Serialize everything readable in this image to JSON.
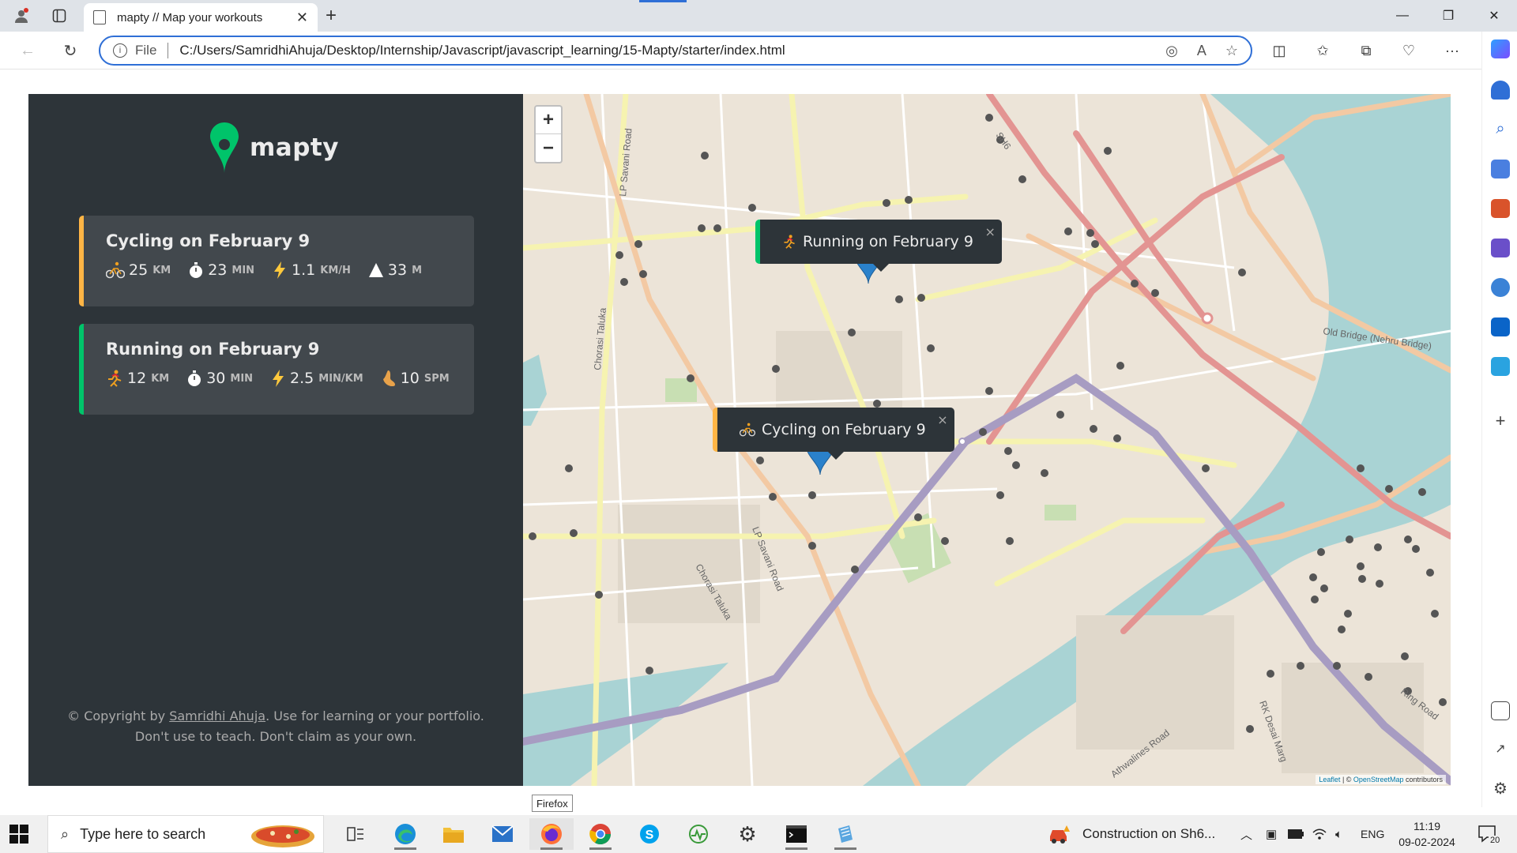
{
  "browser": {
    "tab_title": "mapty // Map your workouts",
    "scheme_label": "File",
    "url": "C:/Users/SamridhiAhuja/Desktop/Internship/Javascript/javascript_learning/15-Mapty/starter/index.html"
  },
  "app": {
    "logo_text": "mapty",
    "brand_colors": {
      "sidebar": "#2d3439",
      "card": "#42484d",
      "running": "#00c46a",
      "cycling": "#ffb545"
    },
    "workouts": [
      {
        "type": "cycling",
        "title": "Cycling on February 9",
        "distance": "25",
        "distance_unit": "KM",
        "duration": "23",
        "duration_unit": "MIN",
        "speed": "1.1",
        "speed_unit": "KM/H",
        "elevation": "33",
        "elevation_unit": "M"
      },
      {
        "type": "running",
        "title": "Running on February 9",
        "distance": "12",
        "distance_unit": "KM",
        "duration": "30",
        "duration_unit": "MIN",
        "pace": "2.5",
        "pace_unit": "MIN/KM",
        "cadence": "10",
        "cadence_unit": "SPM"
      }
    ],
    "copyright": {
      "prefix": "© Copyright by ",
      "author": "Samridhi Ahuja",
      "suffix": ". Use for learning or your portfolio.",
      "line2": "Don't use to teach. Don't claim as your own."
    }
  },
  "map": {
    "zoom_in": "+",
    "zoom_out": "−",
    "popups": {
      "running": "Running on February 9",
      "cycling": "Cycling on February 9",
      "close": "×"
    },
    "labels": {
      "lp_savani_top": "LP Savani Road",
      "lp_savani_mid": "LP Savani Road",
      "chorasi_left": "Chorasi Taluka",
      "chorasi_mid": "Chorasi Taluka",
      "sh6": "SH6",
      "old_bridge": "Old Bridge (Nehru Bridge)",
      "athwalines": "Athwalines Road",
      "rk_desai": "RK Desai Marg",
      "ring_road": "Ring Road"
    },
    "attribution": {
      "leaflet": "Leaflet",
      "sep": " | © ",
      "osm": "OpenStreetMap",
      "contributors": " contributors"
    }
  },
  "taskbar": {
    "tooltip": "Firefox",
    "search_placeholder": "Type here to search",
    "news": "Construction on Sh6...",
    "language": "ENG",
    "time": "11:19",
    "date": "09-02-2024",
    "notifications": "20"
  }
}
